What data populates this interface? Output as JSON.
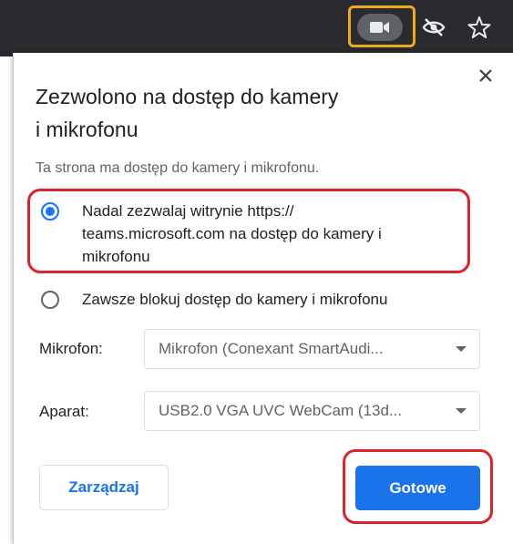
{
  "toolbar": {
    "icons": [
      "camera-icon",
      "eye-off-icon",
      "star-icon"
    ],
    "highlight_color": "#f2a81d"
  },
  "dialog": {
    "close_icon": "close-icon",
    "title_line1": "Zezwolono na dostęp do kamery",
    "title_line2": "i mikrofonu",
    "subtitle": "Ta strona ma dostęp do kamery i mikrofonu.",
    "options": [
      {
        "line1": "Nadal zezwalaj witrynie https://",
        "line2": "teams.microsoft.com na dostęp do kamery i",
        "line3": "mikrofonu",
        "selected": true
      },
      {
        "line1": "Zawsze blokuj dostęp do kamery i mikrofonu",
        "selected": false
      }
    ],
    "microphone": {
      "label": "Mikrofon:",
      "value": "Mikrofon (Conexant SmartAudi..."
    },
    "camera": {
      "label": "Aparat:",
      "value": "USB2.0 VGA UVC WebCam (13d..."
    },
    "manage_label": "Zarządzaj",
    "done_label": "Gotowe",
    "accent_color": "#1a73e8",
    "annotation_color": "#e0202a"
  }
}
